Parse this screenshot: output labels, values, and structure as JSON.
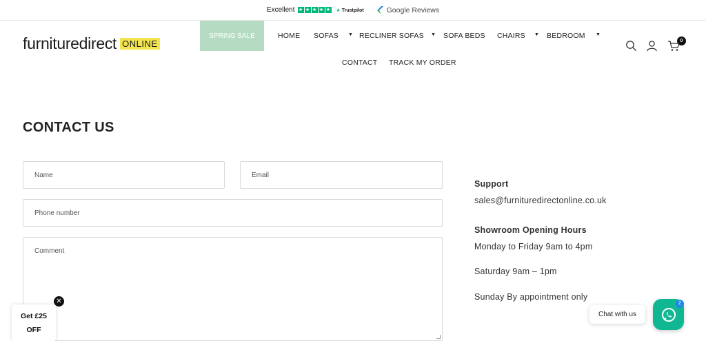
{
  "topbar": {
    "trustpilot_rating": "Excellent",
    "trustpilot_brand": "Trustpilot",
    "google_reviews": "Google Reviews"
  },
  "header": {
    "logo_text": "furnituredirect",
    "logo_badge": "ONLINE",
    "sale_label": "SPRING SALE",
    "nav": {
      "home": "HOME",
      "sofas": "SOFAS",
      "recliner_sofas": "RECLINER SOFAS",
      "sofa_beds": "SOFA BEDS",
      "chairs": "CHAIRS",
      "bedroom": "BEDROOM",
      "contact": "CONTACT",
      "track_order": "TRACK MY ORDER"
    },
    "cart_count": "0"
  },
  "page": {
    "title": "CONTACT US"
  },
  "form": {
    "name_placeholder": "Name",
    "email_placeholder": "Email",
    "phone_placeholder": "Phone number",
    "comment_placeholder": "Comment"
  },
  "info": {
    "support_heading": "Support",
    "support_email": "sales@furnituredirectonline.co.uk",
    "hours_heading": "Showroom Opening Hours",
    "weekday_hours": "Monday to Friday 9am to 4pm",
    "saturday_hours": "Saturday 9am – 1pm",
    "sunday_hours": "Sunday By appointment only"
  },
  "promo": {
    "line1": "Get £25",
    "line2": "OFF"
  },
  "chat": {
    "label": "Chat with us",
    "badge_count": "2"
  },
  "colors": {
    "accent_green": "#b5dcc2",
    "logo_yellow": "#f1e44f",
    "trustpilot_green": "#00b67a",
    "chat_green": "#0fb892"
  }
}
